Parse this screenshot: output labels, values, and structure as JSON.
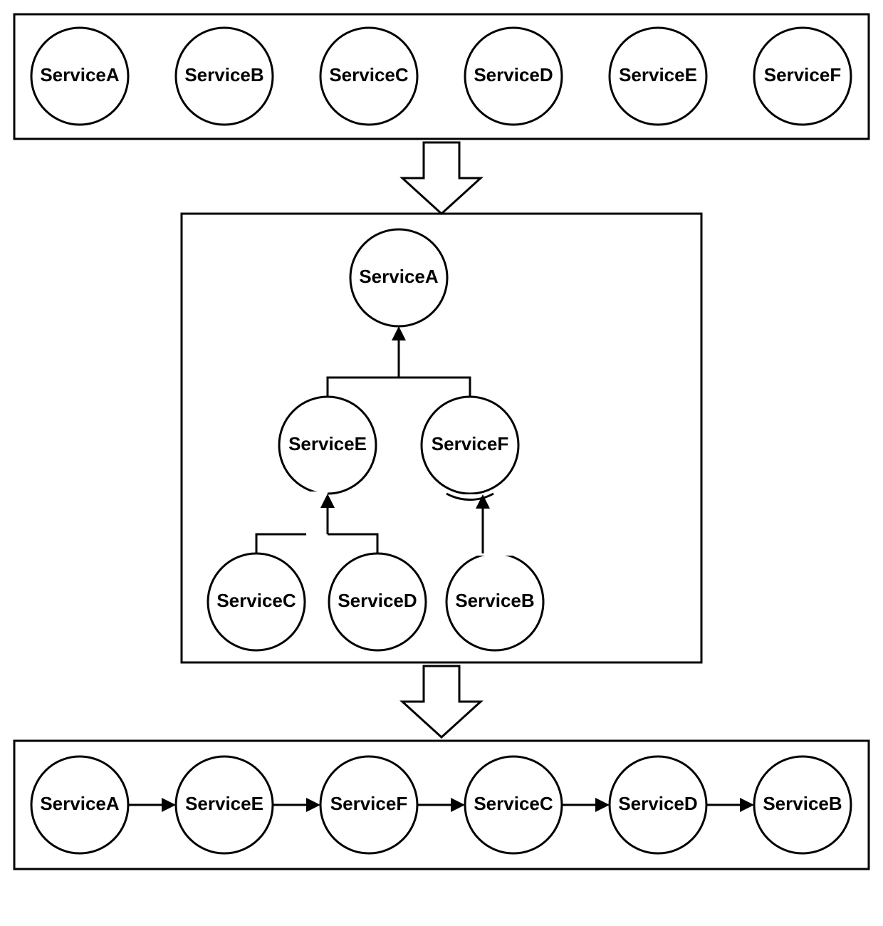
{
  "box1": {
    "nodes": [
      "ServiceA",
      "ServiceB",
      "ServiceC",
      "ServiceD",
      "ServiceE",
      "ServiceF"
    ]
  },
  "tree": {
    "root": "ServiceA",
    "level2": {
      "left": "ServiceE",
      "right": "ServiceF"
    },
    "level3": {
      "c": "ServiceC",
      "d": "ServiceD",
      "b": "ServiceB"
    }
  },
  "box3": {
    "nodes": [
      "ServiceA",
      "ServiceE",
      "ServiceF",
      "ServiceC",
      "ServiceD",
      "ServiceB"
    ]
  },
  "chart_data": {
    "type": "area",
    "title": "",
    "stage1_unordered_services": [
      "ServiceA",
      "ServiceB",
      "ServiceC",
      "ServiceD",
      "ServiceE",
      "ServiceF"
    ],
    "stage2_dependency_tree": {
      "ServiceA": [
        "ServiceE",
        "ServiceF"
      ],
      "ServiceE": [
        "ServiceC",
        "ServiceD"
      ],
      "ServiceF": [
        "ServiceB"
      ],
      "ServiceC": [],
      "ServiceD": [],
      "ServiceB": []
    },
    "stage3_linear_order": [
      "ServiceA",
      "ServiceE",
      "ServiceF",
      "ServiceC",
      "ServiceD",
      "ServiceB"
    ]
  }
}
